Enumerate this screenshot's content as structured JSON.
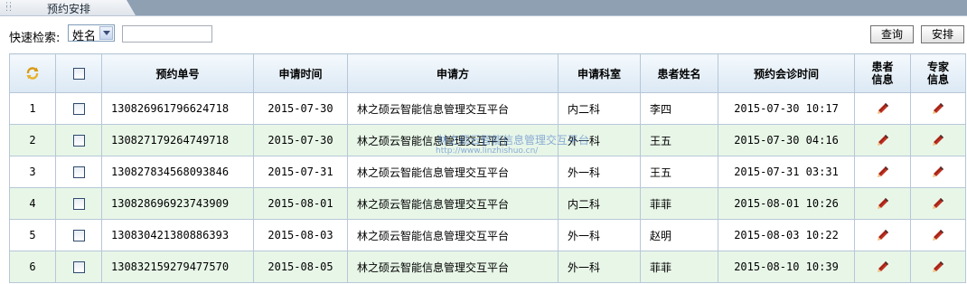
{
  "window": {
    "tab_title": "预约安排"
  },
  "search": {
    "label": "快速检索:",
    "field_selected": "姓名",
    "input_value": "",
    "query_button": "查询",
    "arrange_button": "安排"
  },
  "table": {
    "headers": {
      "order_no": "预约单号",
      "apply_time": "申请时间",
      "applicant": "申请方",
      "department": "申请科室",
      "patient_name": "患者姓名",
      "consult_time": "预约会诊时间",
      "patient_info_1": "患者",
      "patient_info_2": "信息",
      "expert_info_1": "专家",
      "expert_info_2": "信息"
    },
    "rows": [
      {
        "num": "1",
        "order_no": "130826961796624718",
        "apply_time": "2015-07-30",
        "applicant": "林之硕云智能信息管理交互平台",
        "department": "内二科",
        "patient": "李四",
        "consult_time": "2015-07-30 10:17"
      },
      {
        "num": "2",
        "order_no": "130827179264749718",
        "apply_time": "2015-07-30",
        "applicant": "林之硕云智能信息管理交互平台",
        "department": "外一科",
        "patient": "王五",
        "consult_time": "2015-07-30 04:16"
      },
      {
        "num": "3",
        "order_no": "130827834568093846",
        "apply_time": "2015-07-31",
        "applicant": "林之硕云智能信息管理交互平台",
        "department": "外一科",
        "patient": "王五",
        "consult_time": "2015-07-31 03:31"
      },
      {
        "num": "4",
        "order_no": "130828696923743909",
        "apply_time": "2015-08-01",
        "applicant": "林之硕云智能信息管理交互平台",
        "department": "内二科",
        "patient": "菲菲",
        "consult_time": "2015-08-01 10:26"
      },
      {
        "num": "5",
        "order_no": "130830421380886393",
        "apply_time": "2015-08-03",
        "applicant": "林之硕云智能信息管理交互平台",
        "department": "外一科",
        "patient": "赵明",
        "consult_time": "2015-08-03 10:22"
      },
      {
        "num": "6",
        "order_no": "130832159279477570",
        "apply_time": "2015-08-05",
        "applicant": "林之硕云智能信息管理交互平台",
        "department": "外一科",
        "patient": "菲菲",
        "consult_time": "2015-08-10 10:39"
      }
    ]
  },
  "watermark": {
    "text": "林之硕云智能信息管理交互平台",
    "url": "http://www.linzhishuo.cn/"
  },
  "icons": {
    "refresh": "refresh-icon",
    "edit": "pencil-icon",
    "checkbox": "checkbox"
  },
  "colors": {
    "title_bar": "#8ea0b2",
    "row_alt": "#e8f6e8",
    "border": "#b7c7d7"
  }
}
